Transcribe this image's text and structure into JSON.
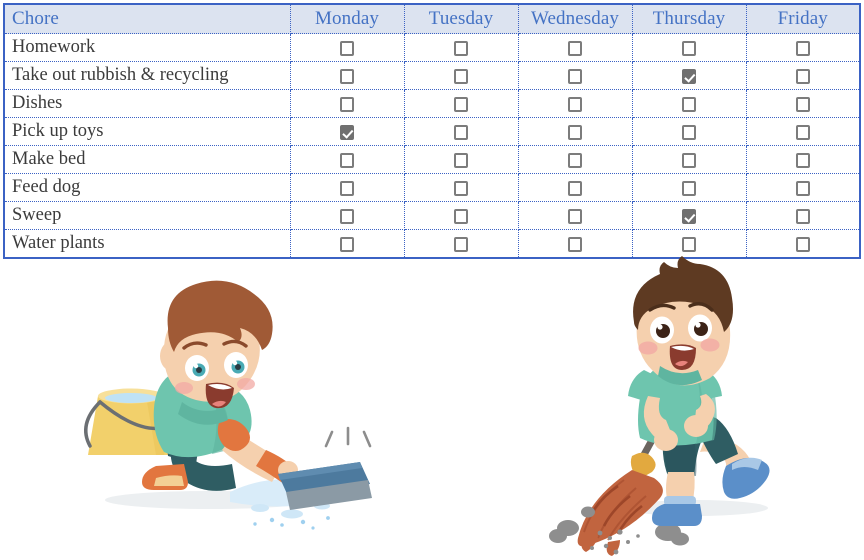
{
  "table": {
    "columns": [
      "Chore",
      "Monday",
      "Tuesday",
      "Wednesday",
      "Thursday",
      "Friday"
    ],
    "rows": [
      {
        "chore": "Homework",
        "checks": [
          false,
          false,
          false,
          false,
          false
        ]
      },
      {
        "chore": "Take out rubbish & recycling",
        "checks": [
          false,
          false,
          false,
          true,
          false
        ]
      },
      {
        "chore": "Dishes",
        "checks": [
          false,
          false,
          false,
          false,
          false
        ]
      },
      {
        "chore": "Pick up toys",
        "checks": [
          true,
          false,
          false,
          false,
          false
        ]
      },
      {
        "chore": "Make bed",
        "checks": [
          false,
          false,
          false,
          false,
          false
        ]
      },
      {
        "chore": "Feed dog",
        "checks": [
          false,
          false,
          false,
          false,
          false
        ]
      },
      {
        "chore": "Sweep",
        "checks": [
          false,
          false,
          false,
          true,
          false
        ]
      },
      {
        "chore": "Water plants",
        "checks": [
          false,
          false,
          false,
          false,
          false
        ]
      }
    ]
  },
  "illustrations": [
    {
      "name": "boy-scrubbing-floor",
      "alt": "Cartoon boy kneeling and scrubbing the floor with a blue sponge next to a yellow bucket of water"
    },
    {
      "name": "boy-sweeping-floor",
      "alt": "Cartoon boy sweeping dirt on the floor with an orange broom"
    }
  ],
  "colors": {
    "header_bg": "#dce3f0",
    "header_text": "#4472c4",
    "table_border": "#3b62c4",
    "grid_line": "#3b62c4",
    "body_text": "#3b3b3b",
    "checkbox_border": "#7c7c7c",
    "checkbox_checked_fill": "#707070",
    "shirt_teal": "#6ec5ae",
    "hair_brown": "#a05a36",
    "bucket_yellow": "#f2d06b",
    "broom_orange": "#c1643f",
    "shoe_blue": "#5b8fc9",
    "pants_teal": "#2f5d63"
  }
}
